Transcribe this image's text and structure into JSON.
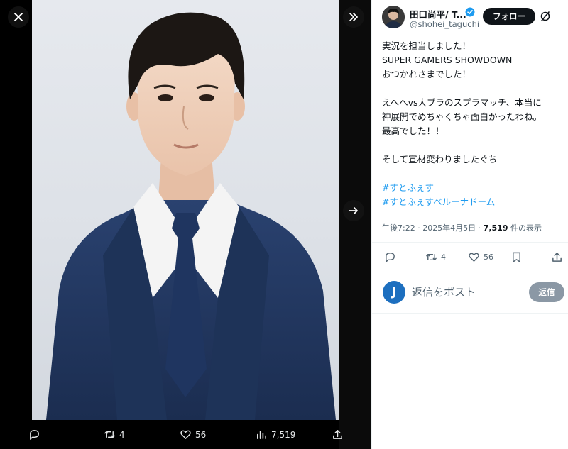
{
  "viewer": {
    "actions": {
      "replies": "",
      "retweets": "4",
      "likes": "56",
      "views": "7,519"
    }
  },
  "tweet": {
    "author": {
      "display_name": "田口尚平/ T...",
      "handle": "@shohei_taguchi"
    },
    "follow_label": "フォロー",
    "body_lines": [
      "実況を担当しました！",
      "SUPER GAMERS SHOWDOWN",
      "おつかれさまでした！",
      "",
      "えへへvs大ブラのスプラマッチ、本当に",
      "神展開でめちゃくちゃ面白かったわね。",
      "最高でした！！",
      "",
      "そして宣材変わりましたぐち",
      ""
    ],
    "hashtags": [
      "#すとふぇす",
      "#すとふぇすベルーナドーム"
    ],
    "meta": {
      "time": "午後7:22 · 2025年4月5日 · ",
      "views_count": "7,519",
      "views_suffix": " 件の表示"
    },
    "actions": {
      "retweets": "4",
      "likes": "56"
    }
  },
  "reply": {
    "avatar_letter": "J",
    "placeholder": "返信をポスト",
    "button_label": "返信"
  },
  "colors": {
    "accent": "#1d9bf0",
    "text": "#0f1419",
    "muted": "#536471",
    "suit": "#22385f"
  },
  "icons": [
    "close-icon",
    "collapse-panel-icon",
    "next-arrow-icon",
    "reply-icon",
    "retweet-icon",
    "like-icon",
    "views-icon",
    "share-icon",
    "bookmark-icon",
    "verified-badge-icon",
    "grok-icon"
  ]
}
